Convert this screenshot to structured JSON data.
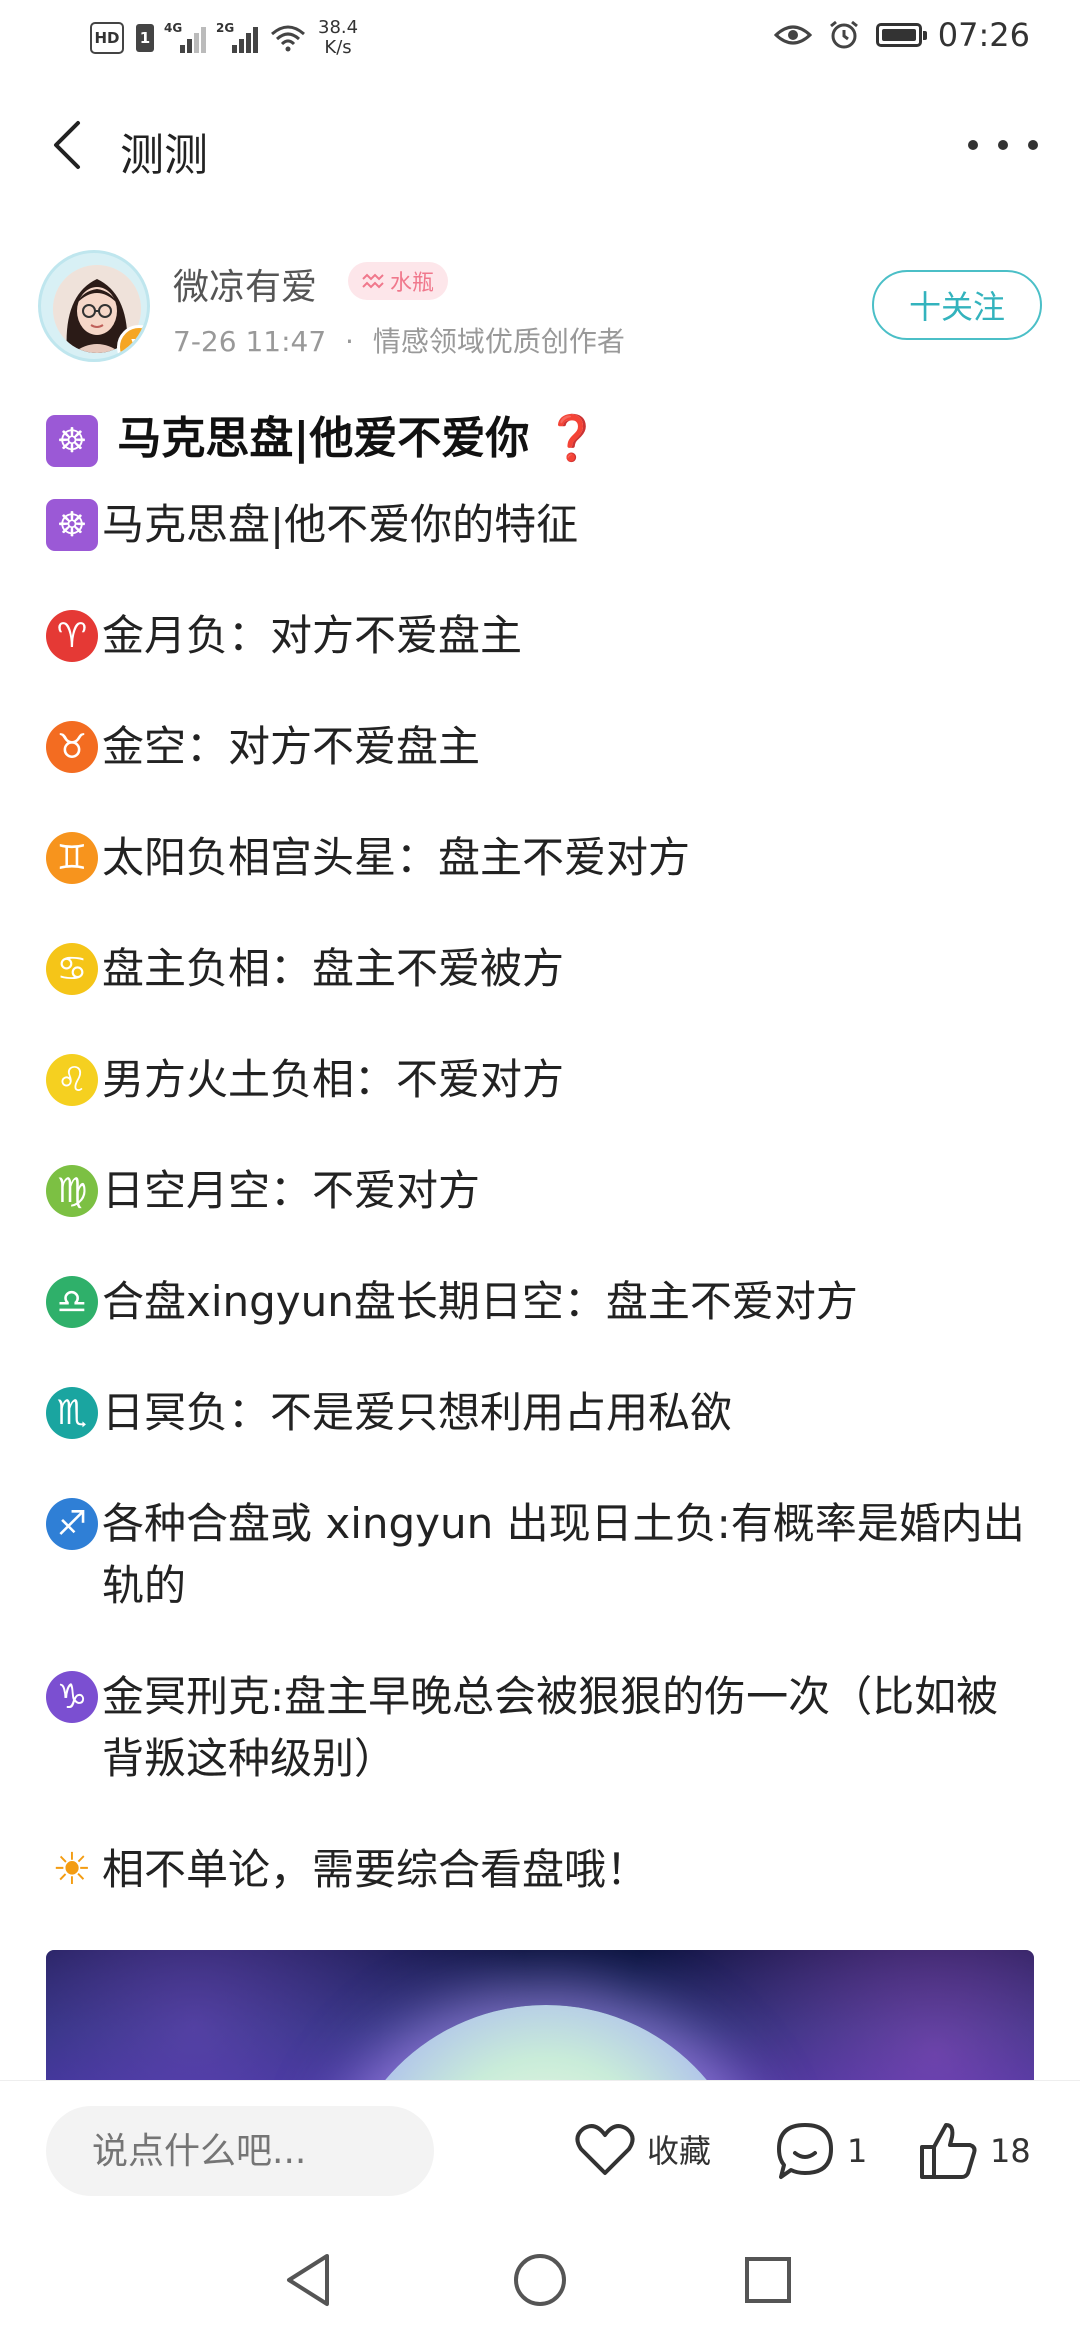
{
  "status_bar": {
    "net_gen_1": "4G",
    "net_gen_2": "2G",
    "speed_value": "38.4",
    "speed_unit": "K/s",
    "time": "07:26"
  },
  "header": {
    "title": "测测"
  },
  "author": {
    "name": "微凉有爱",
    "zodiac_tag": "水瓶",
    "date": "7-26 11:47",
    "separator": "·",
    "role": "情感领域优质创作者",
    "badge": "V",
    "follow_label": "十关注"
  },
  "post": {
    "title_emoji": "☸",
    "title": "马克思盘|他爱不爱你",
    "title_end_emoji": "❓",
    "lines": [
      {
        "emoji": "☸",
        "color": "#9b59d6",
        "text": "马克思盘|他不爱你的特征"
      },
      {
        "emoji": "♈",
        "color": "#e53935",
        "text": "金月负：对方不爱盘主"
      },
      {
        "emoji": "♉",
        "color": "#f36c21",
        "text": "金空：对方不爱盘主"
      },
      {
        "emoji": "♊",
        "color": "#f7941d",
        "text": "太阳负相宫头星：盘主不爱对方"
      },
      {
        "emoji": "♋",
        "color": "#f5c518",
        "text": "盘主负相：盘主不爱被方"
      },
      {
        "emoji": "♌",
        "color": "#f5d020",
        "text": "男方火土负相：不爱对方"
      },
      {
        "emoji": "♍",
        "color": "#7cc043",
        "text": "日空月空：不爱对方"
      },
      {
        "emoji": "♎",
        "color": "#2fb06a",
        "text": "合盘xingyun盘长期日空：盘主不爱对方"
      },
      {
        "emoji": "♏",
        "color": "#1aa5a0",
        "text": "日冥负：不是爱只想利用占用私欲"
      },
      {
        "emoji": "♐",
        "color": "#2f7fd6",
        "text": "各种合盘或 xingyun 出现日土负:有概率是婚内出轨的"
      },
      {
        "emoji": "♑",
        "color": "#7b4fd1",
        "text": "金冥刑克:盘主早晚总会被狠狠的伤一次（比如被背叛这种级别）"
      },
      {
        "emoji": "☀",
        "color": "#f39c12",
        "text": "相不单论，需要综合看盘哦！"
      }
    ]
  },
  "actions": {
    "comment_placeholder": "说点什么吧...",
    "favorite_label": "收藏",
    "comment_count": "1",
    "like_count": "18"
  },
  "colors": {
    "accent": "#33b3bd",
    "tag_bg": "#fde6ea",
    "tag_fg": "#f0788c",
    "verified": "#f5a623"
  }
}
